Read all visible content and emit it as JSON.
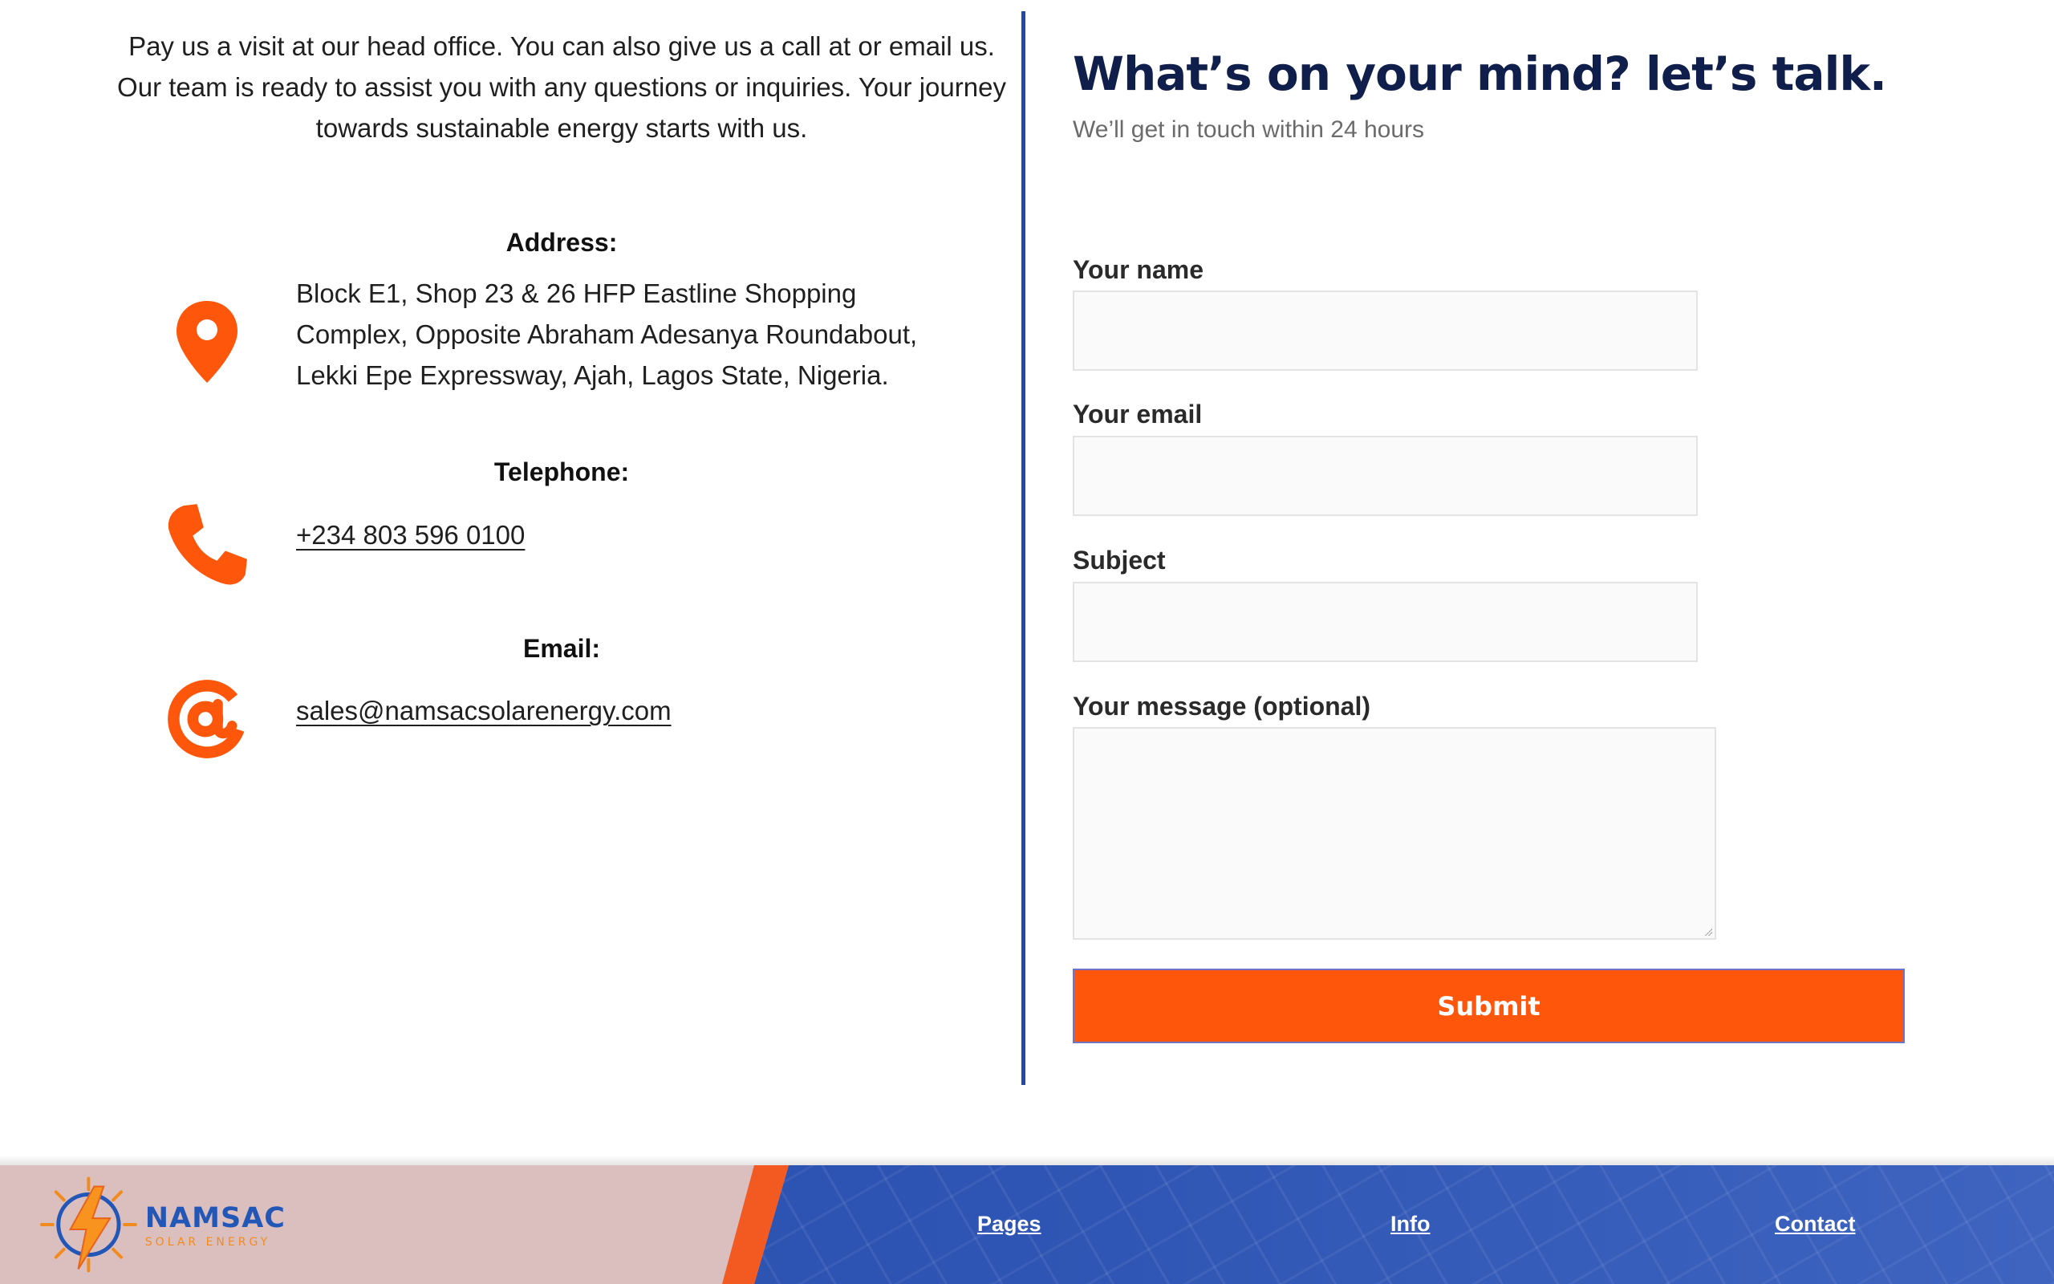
{
  "intro": {
    "text": "Pay us a visit at our head office. You can also give us a call at or email us. Our team is ready to assist you with any questions or inquiries. Your journey towards sustainable energy starts with us."
  },
  "address": {
    "title": "Address:",
    "text": "Block E1, Shop 23 & 26 HFP Eastline Shopping Complex, Opposite Abraham Adesanya Roundabout, Lekki Epe Expressway, Ajah, Lagos State, Nigeria.",
    "icon": "map-pin-icon"
  },
  "telephone": {
    "title": "Telephone:",
    "value": "+234 803 596 0100",
    "icon": "phone-icon"
  },
  "email": {
    "title": "Email:",
    "value": "sales@namsacsolarenergy.com",
    "icon": "at-sign-icon"
  },
  "form": {
    "heading": "What’s on your mind? let’s talk.",
    "subheading": "We’ll get in touch within 24 hours",
    "name_label": "Your name",
    "email_label": "Your email",
    "subject_label": "Subject",
    "message_label": "Your message (optional)",
    "name_value": "",
    "email_value": "",
    "subject_value": "",
    "message_value": "",
    "submit_label": "Submit"
  },
  "footer": {
    "logo_main": "NAMSAC",
    "logo_sub": "SOLAR ENERGY",
    "nav": [
      "Pages",
      "Info",
      "Contact"
    ]
  },
  "colors": {
    "accent_orange": "#fe560a",
    "divider_blue": "#1f4aa8",
    "heading_navy": "#0f1e4a"
  }
}
